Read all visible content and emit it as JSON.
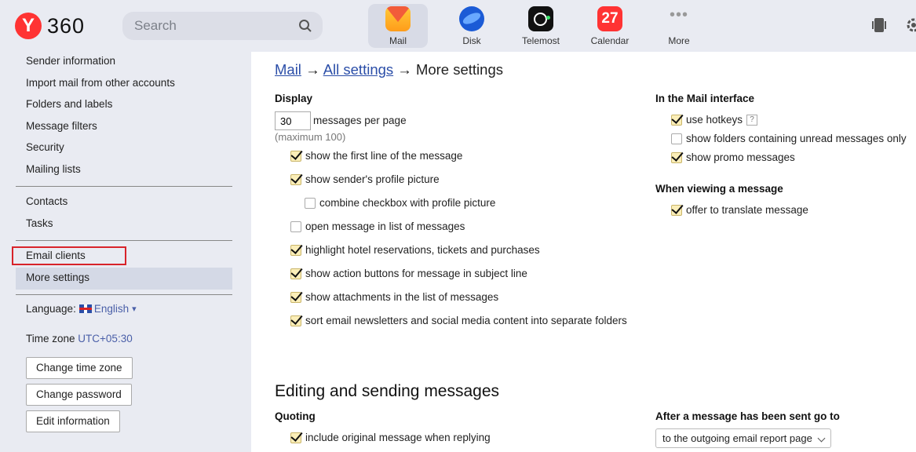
{
  "header": {
    "logo_letter": "Y",
    "logo_text": "360",
    "search_placeholder": "Search",
    "apps": [
      {
        "label": "Mail",
        "icon": "mail-icon"
      },
      {
        "label": "Disk",
        "icon": "disk-icon"
      },
      {
        "label": "Telemost",
        "icon": "telemost-icon"
      },
      {
        "label": "Calendar",
        "icon": "calendar-icon",
        "badge": "27"
      },
      {
        "label": "More",
        "icon": "more-icon",
        "glyph": "•••"
      }
    ]
  },
  "sidebar": {
    "items": [
      "Sender information",
      "Import mail from other accounts",
      "Folders and labels",
      "Message filters",
      "Security",
      "Mailing lists",
      "Contacts",
      "Tasks",
      "Email clients",
      "More settings"
    ],
    "language_label": "Language:",
    "language_value": "English",
    "language_caret": "▾",
    "timezone_label": "Time zone",
    "timezone_value": "UTC+05:30",
    "buttons": [
      "Change time zone",
      "Change password",
      "Edit information"
    ]
  },
  "main": {
    "breadcrumb": {
      "part1": "Mail",
      "arrow": "→",
      "part2": "All settings",
      "current": "More settings"
    },
    "display": {
      "title": "Display",
      "per_page_value": "30",
      "per_page_label": "messages per page",
      "hint": "(maximum 100)",
      "options": [
        {
          "label": "show the first line of the message",
          "checked": true
        },
        {
          "label": "show sender's profile picture",
          "checked": true
        },
        {
          "label": "combine checkbox with profile picture",
          "checked": false
        },
        {
          "label": "open message in list of messages",
          "checked": false
        },
        {
          "label": "highlight hotel reservations, tickets and purchases",
          "checked": true
        },
        {
          "label": "show action buttons for message in subject line",
          "checked": true
        },
        {
          "label": "show attachments in the list of messages",
          "checked": true
        },
        {
          "label": "sort email newsletters and social media content into separate folders",
          "checked": true
        }
      ]
    },
    "interface": {
      "title": "In the Mail interface",
      "options": [
        {
          "label": "use hotkeys",
          "checked": true,
          "help": "?"
        },
        {
          "label": "show folders containing unread messages only",
          "checked": false
        },
        {
          "label": "show promo messages",
          "checked": true
        }
      ]
    },
    "viewing": {
      "title": "When viewing a message",
      "options": [
        {
          "label": "offer to translate message",
          "checked": true
        }
      ]
    },
    "editing": {
      "title": "Editing and sending messages",
      "quoting_title": "Quoting",
      "quoting_options": [
        {
          "label": "include original message when replying",
          "checked": true
        }
      ],
      "after_sent_title": "After a message has been sent go to",
      "after_sent_value": "to the outgoing email report page"
    }
  }
}
